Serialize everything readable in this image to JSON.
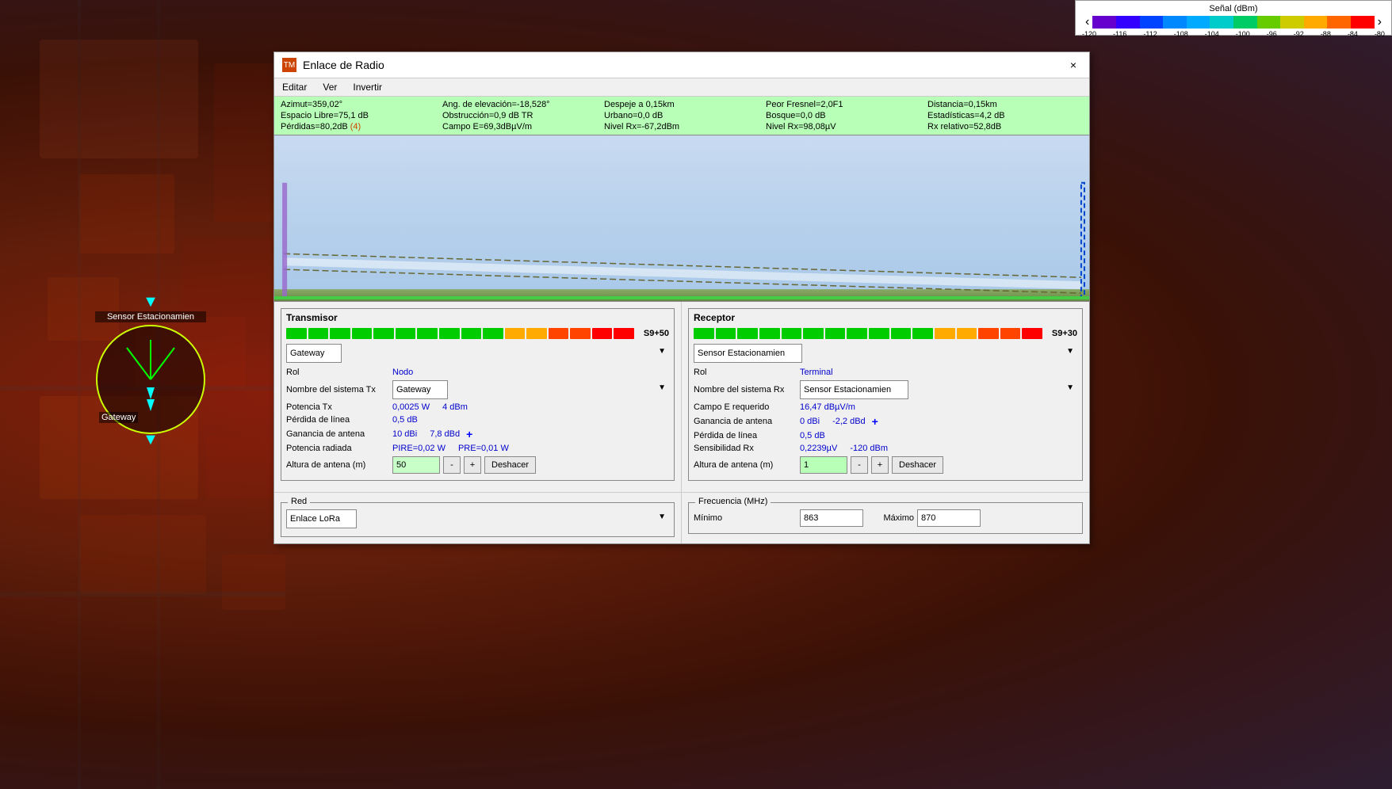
{
  "map": {
    "signal_bar": {
      "title": "Señal (dBm)",
      "nav_left": "‹",
      "nav_right": "›",
      "labels": [
        "-120",
        "-116",
        "-112",
        "-108",
        "-104",
        "-100",
        "-96",
        "-92",
        "-88",
        "-84",
        "-80"
      ]
    }
  },
  "dialog": {
    "icon": "TM",
    "title": "Enlace de Radio",
    "close": "×",
    "menu": [
      "Editar",
      "Ver",
      "Invertir"
    ]
  },
  "info_bar": {
    "row1": {
      "col1": "Azimut=359,02°",
      "col2": "Ang. de elevación=-18,528°",
      "col3": "Despeje a 0,15km",
      "col4": "Peor Fresnel=2,0F1",
      "col5": "Distancia=0,15km"
    },
    "row2": {
      "col1": "Espacio Libre=75,1 dB",
      "col2": "Obstrucción=0,9 dB TR",
      "col3": "Urbano=0,0 dB",
      "col4": "Bosque=0,0 dB",
      "col5": "Estadísticas=4,2 dB"
    },
    "row3": {
      "col1": "Pérdidas=80,2dB",
      "col1b": "(4)",
      "col2": "Campo E=69,3dBµV/m",
      "col3": "Nivel Rx=-67,2dBm",
      "col4": "Nivel Rx=98,08µV",
      "col5": "Rx relativo=52,8dB"
    }
  },
  "transmisor": {
    "panel_title": "Transmisor",
    "signal_level": "S9+50",
    "device_label": "Gateway",
    "rol_label": "Rol",
    "rol_value": "Nodo",
    "nombre_label": "Nombre del sistema Tx",
    "nombre_value": "Gateway",
    "potencia_label": "Potencia Tx",
    "potencia_value": "0,0025 W",
    "potencia_value2": "4 dBm",
    "perdida_label": "Pérdida de línea",
    "perdida_value": "0,5 dB",
    "ganancia_label": "Ganancia de antena",
    "ganancia_value": "10 dBi",
    "ganancia_value2": "7,8 dBd",
    "ganancia_plus": "+",
    "potencia_rad_label": "Potencia radiada",
    "potencia_rad_value": "PIRE=0,02 W",
    "potencia_rad_value2": "PRE=0,01 W",
    "altura_label": "Altura de antena (m)",
    "altura_value": "50",
    "btn_minus": "-",
    "btn_plus": "+",
    "btn_deshacer": "Deshacer"
  },
  "receptor": {
    "panel_title": "Receptor",
    "signal_level": "S9+30",
    "device_label": "Sensor Estacionamien",
    "rol_label": "Rol",
    "rol_value": "Terminal",
    "nombre_label": "Nombre del sistema Rx",
    "nombre_value": "Sensor Estacionamien",
    "campo_label": "Campo E requerido",
    "campo_value": "16,47 dBµV/m",
    "ganancia_label": "Ganancia de antena",
    "ganancia_value": "0 dBi",
    "ganancia_value2": "-2,2 dBd",
    "ganancia_plus": "+",
    "perdida_label": "Pérdida de línea",
    "perdida_value": "0,5 dB",
    "sensibilidad_label": "Sensibilidad Rx",
    "sensibilidad_value": "0,2239µV",
    "sensibilidad_value2": "-120 dBm",
    "altura_label": "Altura de antena (m)",
    "altura_value": "1",
    "btn_minus": "-",
    "btn_plus": "+",
    "btn_deshacer": "Deshacer"
  },
  "red": {
    "panel_title": "Red",
    "value": "Enlace LoRa"
  },
  "frecuencia": {
    "panel_title": "Frecuencia (MHz)",
    "min_label": "Mínimo",
    "min_value": "863",
    "max_label": "Máximo",
    "max_value": "870"
  },
  "nodes": {
    "sensor": {
      "label": "Sensor Estacionamien"
    },
    "gateway": {
      "label": "Gateway"
    }
  }
}
